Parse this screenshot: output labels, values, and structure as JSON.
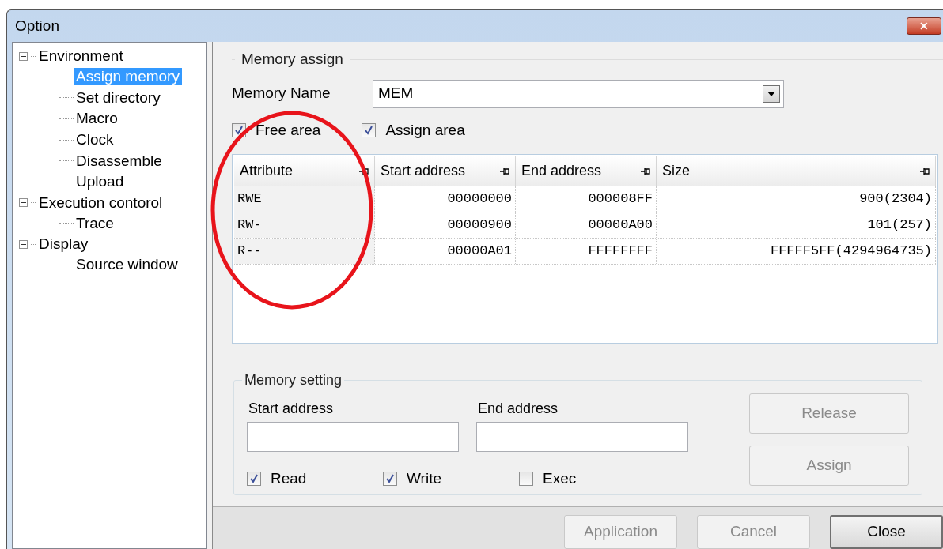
{
  "window": {
    "title": "Option",
    "close_label": "✕"
  },
  "tree": [
    {
      "label": "Environment",
      "expanded": true,
      "selected": false,
      "children": [
        {
          "label": "Assign memory",
          "selected": true
        },
        {
          "label": "Set directory",
          "selected": false
        },
        {
          "label": "Macro",
          "selected": false
        },
        {
          "label": "Clock",
          "selected": false
        },
        {
          "label": "Disassemble",
          "selected": false
        },
        {
          "label": "Upload",
          "selected": false
        }
      ]
    },
    {
      "label": "Execution contorol",
      "expanded": true,
      "selected": false,
      "children": [
        {
          "label": "Trace",
          "selected": false
        }
      ]
    },
    {
      "label": "Display",
      "expanded": true,
      "selected": false,
      "children": [
        {
          "label": "Source window",
          "selected": false
        }
      ]
    }
  ],
  "memory_assign": {
    "title": "Memory assign",
    "memory_name_label": "Memory Name",
    "memory_name_value": "MEM",
    "checkboxes": [
      {
        "label": "Free area",
        "checked": true
      },
      {
        "label": "Assign area",
        "checked": true
      }
    ],
    "table": {
      "columns": [
        "Attribute",
        "Start address",
        "End address",
        "Size"
      ],
      "rows": [
        [
          "RWE",
          "00000000",
          "000008FF",
          "900(2304)"
        ],
        [
          "RW-",
          "00000900",
          "00000A00",
          "101(257)"
        ],
        [
          "R--",
          "00000A01",
          "FFFFFFFF",
          "FFFFF5FF(4294964735)"
        ]
      ]
    }
  },
  "memory_setting": {
    "title": "Memory setting",
    "start_label": "Start address",
    "end_label": "End address",
    "checkboxes": [
      {
        "label": "Read",
        "checked": true
      },
      {
        "label": "Write",
        "checked": true
      },
      {
        "label": "Exec",
        "checked": false
      }
    ],
    "buttons": [
      {
        "label": "Release",
        "disabled": true
      },
      {
        "label": "Assign",
        "disabled": true
      }
    ]
  },
  "footer_buttons": [
    {
      "label": "Application",
      "disabled": true,
      "default": false
    },
    {
      "label": "Cancel",
      "disabled": true,
      "default": false
    },
    {
      "label": "Close",
      "disabled": false,
      "default": true
    }
  ],
  "annotation": {
    "kind": "ellipse",
    "color": "#e8141b"
  }
}
